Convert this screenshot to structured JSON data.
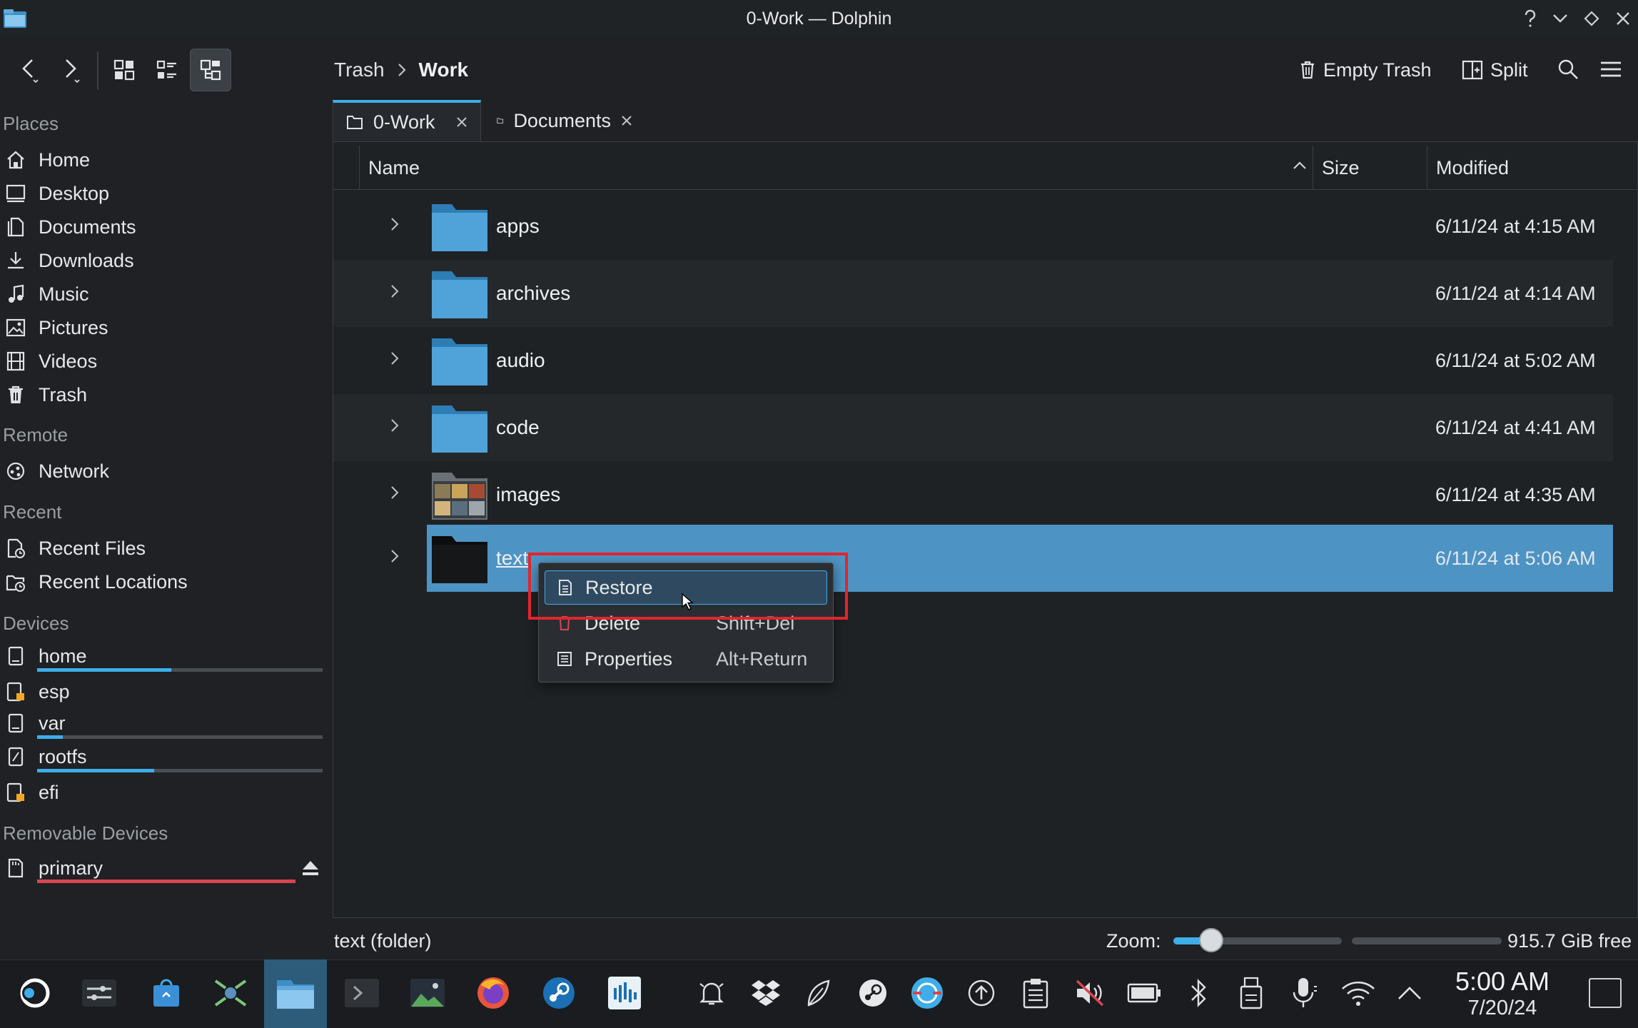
{
  "window": {
    "title": "0-Work — Dolphin"
  },
  "breadcrumb": {
    "parent": "Trash",
    "current": "Work"
  },
  "toolbar": {
    "empty_trash": "Empty Trash",
    "split": "Split"
  },
  "places": {
    "places_title": "Places",
    "places_items": [
      "Home",
      "Desktop",
      "Documents",
      "Downloads",
      "Music",
      "Pictures",
      "Videos",
      "Trash"
    ],
    "remote_title": "Remote",
    "remote_items": [
      "Network"
    ],
    "recent_title": "Recent",
    "recent_items": [
      "Recent Files",
      "Recent Locations"
    ],
    "devices_title": "Devices",
    "devices": [
      {
        "label": "home",
        "usage": 0.47
      },
      {
        "label": "esp"
      },
      {
        "label": "var",
        "usage": 0.09
      },
      {
        "label": "rootfs",
        "usage": 0.41
      },
      {
        "label": "efi"
      }
    ],
    "removable_title": "Removable Devices",
    "removable": [
      {
        "label": "primary",
        "usage": 1.0
      }
    ]
  },
  "tabs": [
    {
      "label": "0-Work"
    },
    {
      "label": "Documents"
    }
  ],
  "columns": {
    "name": "Name",
    "size": "Size",
    "modified": "Modified"
  },
  "files": [
    {
      "name": "apps",
      "modified": "6/11/24 at 4:15 AM"
    },
    {
      "name": "archives",
      "modified": "6/11/24 at 4:14 AM"
    },
    {
      "name": "audio",
      "modified": "6/11/24 at 5:02 AM"
    },
    {
      "name": "code",
      "modified": "6/11/24 at 4:41 AM"
    },
    {
      "name": "images",
      "modified": "6/11/24 at 4:35 AM"
    },
    {
      "name": "text",
      "modified": "6/11/24 at 5:06 AM",
      "selected": true
    }
  ],
  "context_menu": [
    {
      "label": "Restore",
      "shortcut": ""
    },
    {
      "label": "Delete",
      "shortcut": "Shift+Del"
    },
    {
      "label": "Properties",
      "shortcut": "Alt+Return"
    }
  ],
  "status": {
    "text": "text (folder)",
    "zoom_label": "Zoom:",
    "free_space": "915.7 GiB free"
  },
  "clock": {
    "time": "5:00 AM",
    "date": "7/20/24"
  },
  "colors": {
    "accent": "#3daee9",
    "selection": "#4d94c4",
    "warning_red": "#da4453",
    "highlight_box": "#e0262e"
  }
}
